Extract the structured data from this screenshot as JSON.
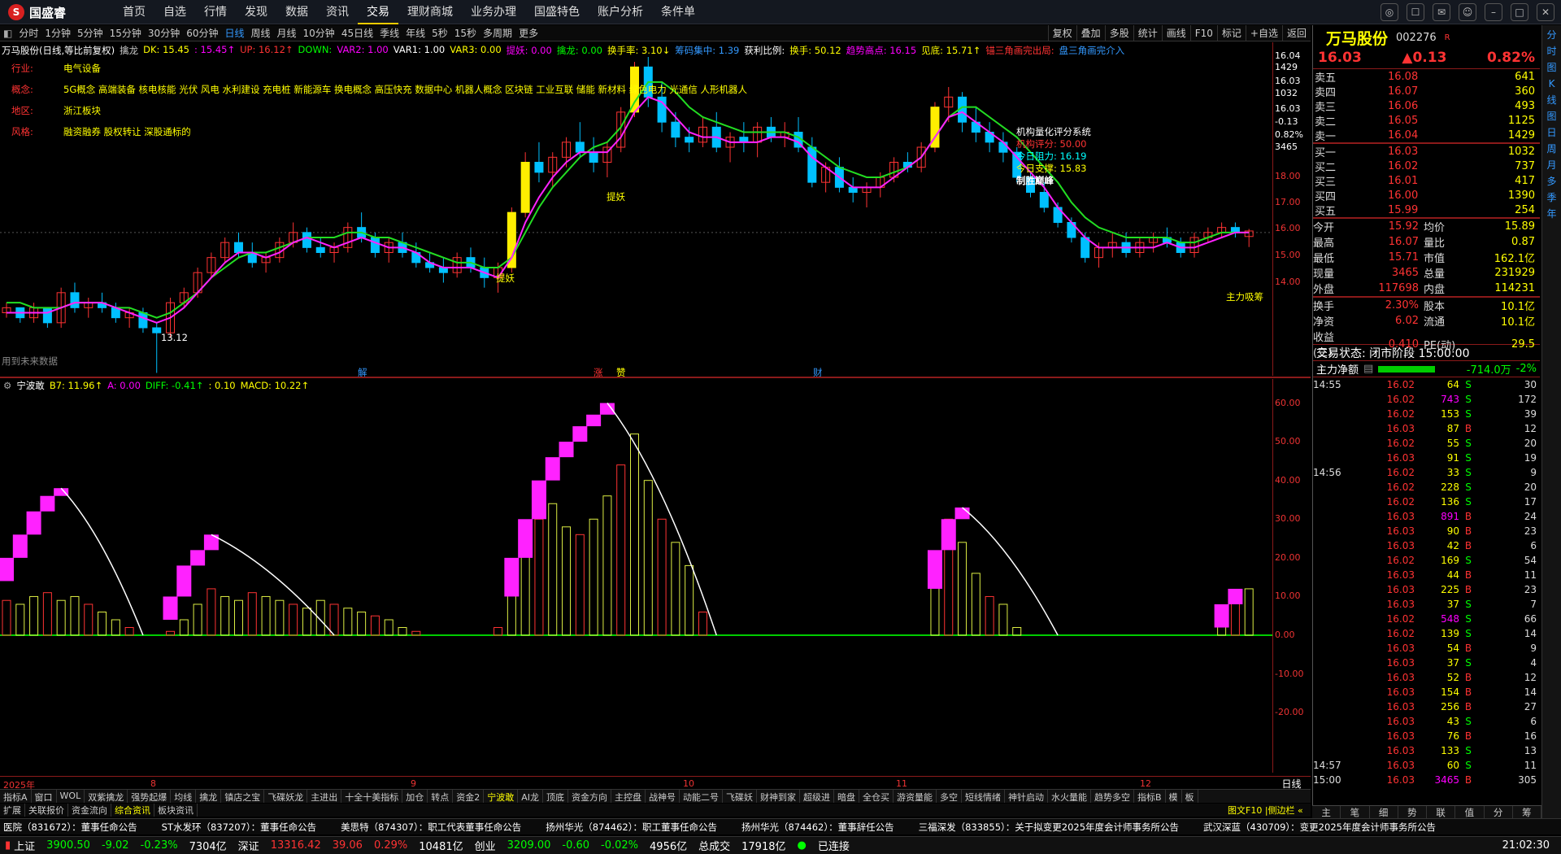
{
  "app": {
    "logo": "国盛睿",
    "nav": [
      "首页",
      "自选",
      "行情",
      "发现",
      "数据",
      "资讯",
      "交易",
      "理财商城",
      "业务办理",
      "国盛特色",
      "账户分析",
      "条件单"
    ],
    "active_nav": "交易",
    "window_icons": [
      "chat-icon",
      "message-icon",
      "mail-icon",
      "user-icon",
      "minimize-icon",
      "maximize-icon",
      "close-icon"
    ]
  },
  "periods": [
    "分时",
    "1分钟",
    "5分钟",
    "15分钟",
    "30分钟",
    "60分钟",
    "日线",
    "周线",
    "月线",
    "10分钟",
    "45日线",
    "季线",
    "年线",
    "5秒",
    "15秒",
    "多周期",
    "更多"
  ],
  "active_period": "日线",
  "tools": [
    "复权",
    "叠加",
    "多股",
    "统计",
    "画线",
    "F10",
    "标记",
    "+自选",
    "返回"
  ],
  "info": {
    "stock": "万马股份(日线,等比前复权)",
    "ind": "擒龙",
    "dk": "DK: 15.45",
    "dk2": ": 15.45↑",
    "up": "UP: 16.12↑",
    "down": "DOWN: ",
    "var2": "VAR2: 1.00",
    "var1": "VAR1: 1.00",
    "var3": "VAR3: 0.00",
    "tiyao": "提妖: 0.00",
    "qinglong": "擒龙: 0.00",
    "huanshou": "换手率: 3.10↓",
    "chouma": "筹码集中: 1.39",
    "huoli": "获利比例: ",
    "huanshou2": "换手: 50.12",
    "qushi": "趋势高点: 16.15",
    "jiandi": "见底: 15.71↑",
    "sanjiao": "锚三角画完出局: ",
    "sanjiao2": "盘三角画完介入"
  },
  "categories": {
    "hangye_k": "行业:",
    "hangye_v": "电气设备",
    "gainian_k": "概念:",
    "gainian_v": "5G概念 高端装备 核电核能 光伏 风电 水利建设 充电桩 新能源车 换电概念 高压快充 数据中心 机器人概念 区块链 工业互联 储能 新材料 绿色电力 光通信 人形机器人",
    "diqu_k": "地区:",
    "diqu_v": "浙江板块",
    "fengge_k": "风格:",
    "fengge_v": "融资融券 股权转让 深股通标的"
  },
  "jigou": {
    "title": "机构量化评分系统",
    "score": "机构评分:  50.00",
    "zuli": "今日阻力:  16.19",
    "zhicheng": "今日支撑:  15.83",
    "zhisheng": "制胜巅峰"
  },
  "labels": {
    "tiyao": "提妖",
    "zhuli": "主力吸筹",
    "weilai": "用到未来数据",
    "low": "13.12",
    "jie": "解",
    "zhang": "涨",
    "zhao": "赞",
    "cai": "财"
  },
  "ind2": {
    "name": "宁波敢",
    "b7": "B7: 11.96↑",
    "a": "A: 0.00",
    "diff": "DIFF: -0.41↑",
    "diff2": ": 0.10",
    "macd": "MACD: 10.22↑"
  },
  "yaxis1": [
    "16.04",
    "1429",
    "16.03",
    "1032",
    "16.03",
    "-0.13",
    "0.82%",
    "3465",
    "18.00",
    "17.00",
    "16.00",
    "15.00",
    "14.00"
  ],
  "yaxis2": [
    "60.00",
    "50.00",
    "40.00",
    "30.00",
    "20.00",
    "10.00",
    "0.00",
    "-10.00",
    "-20.00"
  ],
  "timeaxis": [
    "2025年",
    "8",
    "9",
    "10",
    "11",
    "12"
  ],
  "tabs": [
    "指标A",
    "窗口",
    "WOL",
    "双紫擒龙",
    "强势起爆",
    "均线",
    "擒龙",
    "镇店之宝",
    "飞碟妖龙",
    "主进出",
    "十全十美指标",
    "加仓",
    "转点",
    "资金2",
    "宁波敢",
    "AI龙",
    "顶底",
    "资金方向",
    "主控盘",
    "战神号",
    "动能二号",
    "飞碟妖",
    "财神到家",
    "超级进",
    "暗盘",
    "全仓买",
    "游资量能",
    "多空",
    "短线情绪",
    "神针启动",
    "水火量能",
    "趋势多空",
    "指标B",
    "模",
    "板"
  ],
  "active_tab": "宁波敢",
  "tabs2": [
    "扩展",
    "关联报价",
    "资金流向",
    "综合资讯",
    "板块资讯"
  ],
  "active_tab2": "综合资讯",
  "tabs2_right": "图文F10 |侧边栏 «",
  "news": [
    "医院（831672）：董事任命公告",
    "ST水发环（837207）：董事任命公告",
    "美思特（874307）：职工代表董事任命公告",
    "扬州华光（874462）：职工董事任命公告",
    "扬州华光（874462）：董事辞任公告",
    "三福深发（833855）：关于拟变更2025年度会计师事务所公告",
    "武汉深蓝（430709）：变更2025年度会计师事务所公告"
  ],
  "status": {
    "sh": "上证",
    "sh_v": "3900.50",
    "sh_c": "-9.02",
    "sh_p": "-0.23%",
    "sh_a": "7304亿",
    "sz": "深证",
    "sz_v": "13316.42",
    "sz_c": "39.06",
    "sz_p": "0.29%",
    "sz_a": "10481亿",
    "cy": "创业",
    "cy_v": "3209.00",
    "cy_c": "-0.60",
    "cy_p": "-0.02%",
    "cy_a": "4956亿",
    "zc": "总成交",
    "zc_v": "17918亿",
    "conn": "已连接",
    "time": "21:02:30"
  },
  "quote": {
    "name": "万马股份",
    "code": "002276",
    "flag": "R",
    "price": "16.03",
    "change": "▲0.13",
    "pct": "0.82%"
  },
  "sells": [
    [
      "卖五",
      "16.08",
      "641"
    ],
    [
      "卖四",
      "16.07",
      "360"
    ],
    [
      "卖三",
      "16.06",
      "493"
    ],
    [
      "卖二",
      "16.05",
      "1125"
    ],
    [
      "卖一",
      "16.04",
      "1429"
    ]
  ],
  "buys": [
    [
      "买一",
      "16.03",
      "1032"
    ],
    [
      "买二",
      "16.02",
      "737"
    ],
    [
      "买三",
      "16.01",
      "417"
    ],
    [
      "买四",
      "16.00",
      "1390"
    ],
    [
      "买五",
      "15.99",
      "254"
    ]
  ],
  "stats": [
    [
      "今开",
      "15.92",
      "均价",
      "15.89"
    ],
    [
      "最高",
      "16.07",
      "量比",
      "0.87"
    ],
    [
      "最低",
      "15.71",
      "市值",
      "162.1亿"
    ],
    [
      "现量",
      "3465",
      "总量",
      "231929"
    ],
    [
      "外盘",
      "117698",
      "内盘",
      "114231"
    ]
  ],
  "stats2": [
    [
      "换手",
      "2.30%",
      "股本",
      "10.1亿"
    ],
    [
      "净资",
      "6.02",
      "流通",
      "10.1亿"
    ],
    [
      "收益(三)",
      "0.410",
      "PE(动)",
      "29.5"
    ]
  ],
  "trade_state": "交易状态: 闭市阶段 15:00:00",
  "zhuli": {
    "label": "主力净额",
    "value": "-714.0万",
    "pct": "-2%"
  },
  "ticks": [
    [
      "14:55",
      "16.02",
      "64",
      "S",
      "30"
    ],
    [
      "",
      "16.02",
      "743",
      "S",
      "172"
    ],
    [
      "",
      "16.02",
      "153",
      "S",
      "39"
    ],
    [
      "",
      "16.03",
      "87",
      "B",
      "12"
    ],
    [
      "",
      "16.02",
      "55",
      "S",
      "20"
    ],
    [
      "",
      "16.03",
      "91",
      "S",
      "19"
    ],
    [
      "14:56",
      "16.02",
      "33",
      "S",
      "9"
    ],
    [
      "",
      "16.02",
      "228",
      "S",
      "20"
    ],
    [
      "",
      "16.02",
      "136",
      "S",
      "17"
    ],
    [
      "",
      "16.03",
      "891",
      "B",
      "24"
    ],
    [
      "",
      "16.03",
      "90",
      "B",
      "23"
    ],
    [
      "",
      "16.03",
      "42",
      "B",
      "6"
    ],
    [
      "",
      "16.02",
      "169",
      "S",
      "54"
    ],
    [
      "",
      "16.03",
      "44",
      "B",
      "11"
    ],
    [
      "",
      "16.03",
      "225",
      "B",
      "23"
    ],
    [
      "",
      "16.03",
      "37",
      "S",
      "7"
    ],
    [
      "",
      "16.02",
      "548",
      "S",
      "66"
    ],
    [
      "",
      "16.02",
      "139",
      "S",
      "14"
    ],
    [
      "",
      "16.03",
      "54",
      "B",
      "9"
    ],
    [
      "",
      "16.03",
      "37",
      "S",
      "4"
    ],
    [
      "",
      "16.03",
      "52",
      "B",
      "12"
    ],
    [
      "",
      "16.03",
      "154",
      "B",
      "14"
    ],
    [
      "",
      "16.03",
      "256",
      "B",
      "27"
    ],
    [
      "",
      "16.03",
      "43",
      "S",
      "6"
    ],
    [
      "",
      "16.03",
      "76",
      "B",
      "16"
    ],
    [
      "",
      "16.03",
      "133",
      "S",
      "13"
    ],
    [
      "14:57",
      "16.03",
      "60",
      "S",
      "11"
    ],
    [
      "15:00",
      "16.03",
      "3465",
      "B",
      "305"
    ]
  ],
  "rbot": [
    "主",
    "笔",
    "细",
    "势",
    "联",
    "值",
    "分",
    "筹"
  ],
  "rside": [
    "分",
    "时",
    "图",
    "K",
    "线",
    "图",
    "日",
    "周",
    "月",
    "多",
    "季",
    "年"
  ],
  "chart_data": {
    "type": "candlestick",
    "price_range": [
      13.5,
      19.5
    ],
    "ind_range": [
      -25,
      62
    ],
    "candles": [
      [
        14.4,
        14.6,
        14.3,
        14.5
      ],
      [
        14.5,
        14.5,
        14.2,
        14.3
      ],
      [
        14.3,
        14.6,
        14.2,
        14.5
      ],
      [
        14.5,
        14.5,
        14.1,
        14.2
      ],
      [
        14.2,
        14.9,
        14.1,
        14.8
      ],
      [
        14.8,
        15.0,
        14.4,
        14.5
      ],
      [
        14.5,
        14.7,
        14.3,
        14.6
      ],
      [
        14.6,
        14.8,
        14.4,
        14.5
      ],
      [
        14.5,
        14.6,
        14.2,
        14.3
      ],
      [
        14.3,
        14.5,
        14.1,
        14.4
      ],
      [
        14.4,
        14.5,
        14.0,
        14.1
      ],
      [
        14.1,
        14.2,
        13.2,
        14.0
      ],
      [
        14.0,
        14.7,
        13.9,
        14.6
      ],
      [
        14.6,
        14.9,
        14.5,
        14.8
      ],
      [
        14.8,
        15.3,
        14.7,
        15.2
      ],
      [
        15.2,
        15.6,
        15.1,
        15.5
      ],
      [
        15.5,
        15.9,
        15.4,
        15.8
      ],
      [
        15.8,
        16.0,
        15.5,
        15.6
      ],
      [
        15.6,
        15.8,
        15.3,
        15.4
      ],
      [
        15.4,
        15.6,
        15.2,
        15.5
      ],
      [
        15.5,
        15.9,
        15.4,
        15.8
      ],
      [
        15.8,
        16.2,
        15.7,
        16.0
      ],
      [
        16.0,
        16.1,
        15.6,
        15.7
      ],
      [
        15.7,
        15.9,
        15.5,
        15.6
      ],
      [
        15.6,
        15.8,
        15.4,
        15.7
      ],
      [
        15.7,
        16.2,
        15.6,
        16.1
      ],
      [
        16.1,
        16.4,
        15.8,
        15.9
      ],
      [
        15.9,
        16.0,
        15.5,
        15.6
      ],
      [
        15.6,
        15.9,
        15.4,
        15.8
      ],
      [
        15.8,
        16.0,
        15.5,
        15.6
      ],
      [
        15.6,
        15.8,
        15.3,
        15.4
      ],
      [
        15.4,
        15.6,
        15.2,
        15.3
      ],
      [
        15.3,
        15.5,
        15.0,
        15.2
      ],
      [
        15.2,
        15.6,
        15.1,
        15.5
      ],
      [
        15.5,
        15.7,
        15.2,
        15.3
      ],
      [
        15.3,
        15.5,
        14.9,
        15.1
      ],
      [
        15.1,
        15.4,
        14.8,
        15.3
      ],
      [
        15.3,
        16.5,
        15.2,
        16.4
      ],
      [
        16.4,
        17.6,
        16.3,
        17.4
      ],
      [
        17.4,
        17.8,
        17.0,
        17.2
      ],
      [
        17.2,
        17.6,
        16.9,
        17.5
      ],
      [
        17.5,
        17.9,
        17.3,
        17.8
      ],
      [
        17.8,
        18.2,
        17.5,
        17.6
      ],
      [
        17.6,
        17.9,
        17.2,
        17.4
      ],
      [
        17.4,
        17.8,
        17.1,
        17.7
      ],
      [
        17.7,
        18.5,
        17.6,
        18.4
      ],
      [
        18.4,
        19.4,
        18.3,
        19.3
      ],
      [
        19.3,
        19.5,
        18.5,
        18.7
      ],
      [
        18.7,
        19.0,
        18.0,
        18.2
      ],
      [
        18.2,
        18.4,
        17.7,
        17.9
      ],
      [
        17.9,
        18.1,
        17.6,
        17.8
      ],
      [
        17.8,
        18.3,
        17.7,
        18.1
      ],
      [
        18.1,
        18.4,
        17.6,
        17.7
      ],
      [
        17.7,
        18.0,
        17.4,
        17.9
      ],
      [
        17.9,
        18.2,
        17.6,
        17.8
      ],
      [
        17.8,
        18.2,
        17.5,
        18.1
      ],
      [
        18.1,
        18.3,
        17.8,
        17.9
      ],
      [
        17.9,
        18.2,
        17.7,
        18.0
      ],
      [
        18.0,
        18.3,
        17.6,
        17.7
      ],
      [
        17.7,
        17.9,
        16.9,
        17.0
      ],
      [
        17.0,
        17.4,
        16.8,
        17.3
      ],
      [
        17.3,
        17.5,
        16.8,
        16.9
      ],
      [
        16.9,
        17.1,
        16.6,
        16.8
      ],
      [
        16.8,
        17.0,
        16.5,
        16.9
      ],
      [
        16.9,
        17.2,
        16.7,
        17.1
      ],
      [
        17.1,
        17.5,
        17.0,
        17.4
      ],
      [
        17.4,
        17.6,
        17.2,
        17.3
      ],
      [
        17.3,
        17.8,
        17.2,
        17.7
      ],
      [
        17.7,
        18.6,
        17.6,
        18.5
      ],
      [
        18.5,
        18.9,
        18.2,
        18.7
      ],
      [
        18.7,
        18.8,
        18.0,
        18.2
      ],
      [
        18.2,
        18.5,
        17.8,
        18.0
      ],
      [
        18.0,
        18.2,
        17.6,
        17.8
      ],
      [
        17.8,
        18.0,
        17.4,
        17.6
      ],
      [
        17.6,
        17.7,
        17.0,
        17.1
      ],
      [
        17.1,
        17.2,
        16.7,
        16.8
      ],
      [
        16.8,
        17.0,
        16.4,
        16.5
      ],
      [
        16.5,
        16.6,
        16.1,
        16.2
      ],
      [
        16.2,
        16.3,
        15.8,
        15.9
      ],
      [
        15.9,
        16.0,
        15.4,
        15.5
      ],
      [
        15.5,
        15.8,
        15.3,
        15.7
      ],
      [
        15.7,
        16.0,
        15.5,
        15.8
      ],
      [
        15.8,
        16.0,
        15.5,
        15.6
      ],
      [
        15.6,
        15.9,
        15.5,
        15.8
      ],
      [
        15.8,
        16.0,
        15.6,
        15.9
      ],
      [
        15.9,
        16.1,
        15.7,
        15.8
      ],
      [
        15.8,
        15.9,
        15.5,
        15.6
      ],
      [
        15.6,
        16.0,
        15.5,
        15.9
      ],
      [
        15.9,
        16.1,
        15.8,
        16.0
      ],
      [
        16.0,
        16.2,
        15.9,
        16.1
      ],
      [
        16.1,
        16.2,
        15.9,
        16.0
      ],
      [
        15.92,
        16.07,
        15.71,
        16.03
      ]
    ],
    "ma_green": [
      14.6,
      14.6,
      14.5,
      14.5,
      14.5,
      14.6,
      14.6,
      14.6,
      14.5,
      14.5,
      14.4,
      14.3,
      14.4,
      14.6,
      14.8,
      15.1,
      15.3,
      15.5,
      15.6,
      15.6,
      15.7,
      15.8,
      15.9,
      15.9,
      15.9,
      16.0,
      16.0,
      15.9,
      15.9,
      15.8,
      15.7,
      15.6,
      15.5,
      15.4,
      15.4,
      15.3,
      15.3,
      15.5,
      16.0,
      16.5,
      16.9,
      17.2,
      17.5,
      17.7,
      17.8,
      18.1,
      18.6,
      19.0,
      19.0,
      18.8,
      18.5,
      18.3,
      18.2,
      18.1,
      18.0,
      18.0,
      18.0,
      18.0,
      17.9,
      17.7,
      17.5,
      17.3,
      17.2,
      17.1,
      17.1,
      17.2,
      17.3,
      17.5,
      17.9,
      18.3,
      18.5,
      18.5,
      18.3,
      18.1,
      17.9,
      17.6,
      17.3,
      17.0,
      16.6,
      16.3,
      16.1,
      16.0,
      15.9,
      15.9,
      15.9,
      15.9,
      15.8,
      15.8,
      15.9,
      16.0,
      16.0,
      16.0
    ],
    "ma_red": [
      14.4,
      14.4,
      14.4,
      14.4,
      14.5,
      14.6,
      14.6,
      14.6,
      14.5,
      14.4,
      14.3,
      14.2,
      14.3,
      14.5,
      14.8,
      15.1,
      15.4,
      15.6,
      15.6,
      15.5,
      15.6,
      15.8,
      15.9,
      15.8,
      15.7,
      15.8,
      15.9,
      15.8,
      15.7,
      15.7,
      15.6,
      15.4,
      15.3,
      15.3,
      15.3,
      15.2,
      15.1,
      15.5,
      16.2,
      16.7,
      17.1,
      17.4,
      17.6,
      17.6,
      17.6,
      17.9,
      18.4,
      18.7,
      18.6,
      18.3,
      18.0,
      17.9,
      17.9,
      17.8,
      17.8,
      17.8,
      17.9,
      17.9,
      17.8,
      17.5,
      17.3,
      17.1,
      16.9,
      16.9,
      16.9,
      17.1,
      17.3,
      17.5,
      17.9,
      18.3,
      18.4,
      18.2,
      18.0,
      17.8,
      17.5,
      17.2,
      16.9,
      16.5,
      16.2,
      15.9,
      15.7,
      15.7,
      15.7,
      15.7,
      15.7,
      15.8,
      15.7,
      15.7,
      15.8,
      15.9,
      16.0,
      16.0
    ],
    "hist": [
      [
        9,
        8,
        10,
        11,
        9,
        10,
        8,
        6,
        4,
        2,
        0,
        0,
        1,
        4,
        8,
        12,
        10,
        9,
        11,
        10,
        9,
        8,
        7,
        9,
        8,
        7,
        6,
        5,
        4,
        2,
        1,
        0,
        0,
        0,
        0,
        0,
        2,
        12,
        22,
        30,
        34,
        28,
        26,
        30,
        36,
        44,
        52,
        40,
        30,
        24,
        18,
        6,
        0,
        0,
        0,
        0,
        0,
        0,
        0,
        0,
        0,
        0,
        0,
        0,
        0,
        0,
        0,
        0,
        14,
        30,
        24,
        16,
        10,
        8,
        2,
        0,
        0,
        0,
        0,
        0,
        0,
        0,
        0,
        0,
        0,
        0,
        0,
        0,
        0,
        6,
        10,
        12
      ]
    ],
    "blocks": [
      [
        0,
        14,
        20
      ],
      [
        1,
        20,
        26
      ],
      [
        2,
        26,
        32
      ],
      [
        3,
        32,
        36
      ],
      [
        4,
        36,
        38
      ],
      [
        12,
        4,
        10
      ],
      [
        13,
        10,
        18
      ],
      [
        14,
        18,
        22
      ],
      [
        15,
        22,
        26
      ],
      [
        37,
        10,
        20
      ],
      [
        38,
        20,
        30
      ],
      [
        39,
        30,
        40
      ],
      [
        40,
        40,
        46
      ],
      [
        41,
        46,
        50
      ],
      [
        42,
        50,
        54
      ],
      [
        43,
        54,
        57
      ],
      [
        44,
        57,
        60
      ],
      [
        68,
        12,
        22
      ],
      [
        69,
        22,
        30
      ],
      [
        70,
        30,
        33
      ],
      [
        89,
        2,
        8
      ],
      [
        90,
        8,
        12
      ]
    ]
  }
}
